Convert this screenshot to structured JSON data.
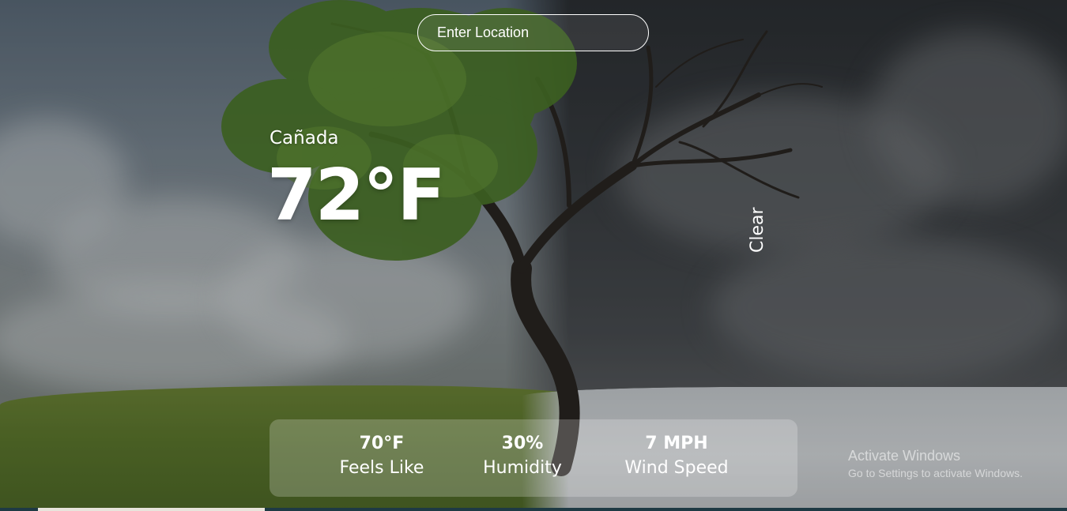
{
  "search": {
    "placeholder": "Enter Location"
  },
  "weather": {
    "location": "Cañada",
    "temperature": "72°F",
    "condition": "Clear"
  },
  "stats": {
    "feels_like": {
      "value": "70°F",
      "label": "Feels Like"
    },
    "humidity": {
      "value": "30%",
      "label": "Humidity"
    },
    "wind": {
      "value": "7 MPH",
      "label": "Wind Speed"
    }
  },
  "watermark": {
    "title": "Activate Windows",
    "subtitle": "Go to Settings to activate Windows."
  }
}
